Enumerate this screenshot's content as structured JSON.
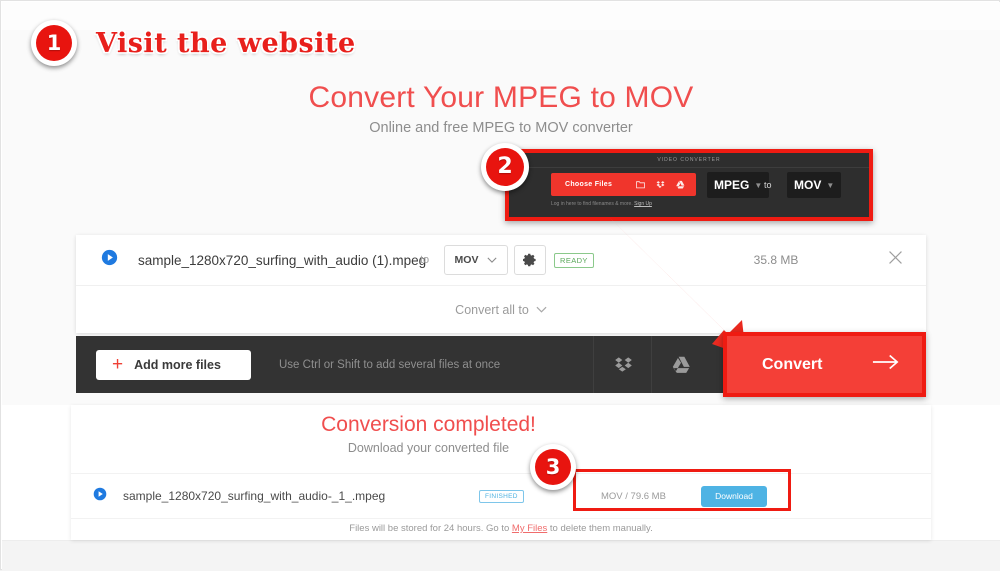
{
  "steps": [
    {
      "number": "1",
      "caption": "Visit the website"
    },
    {
      "number": "2",
      "caption": ""
    },
    {
      "number": "3",
      "caption": ""
    }
  ],
  "hero": {
    "title": "Convert Your MPEG to MOV",
    "subtitle": "Online and free MPEG to MOV converter"
  },
  "widget": {
    "tab_label": "Video Converter",
    "choose_files_label": "Choose Files",
    "icons": [
      "folder-icon",
      "dropbox-icon",
      "google-drive-icon"
    ],
    "format_from": "MPEG",
    "format_to_label": "to",
    "format_to": "MOV",
    "note": "Log in here to find filenames & more.",
    "note_link": "Sign Up"
  },
  "file_panel": {
    "play_icon": "play-circle-icon",
    "filename": "sample_1280x720_surfing_with_audio (1).mpeg",
    "to_label": "to",
    "output_format": "MOV",
    "settings_icon": "gear-icon",
    "status_badge": "READY",
    "filesize": "35.8 MB",
    "remove_icon": "close-icon",
    "convert_all_label": "Convert all to"
  },
  "toolbar": {
    "add_more_label": "Add more files",
    "plus_icon": "plus-icon",
    "hint": "Use Ctrl or Shift to add several files at once",
    "dropbox_icon": "dropbox-icon",
    "drive_icon": "google-drive-icon",
    "convert_label": "Convert",
    "convert_arrow_icon": "arrow-right-icon"
  },
  "completed": {
    "title": "Conversion completed!",
    "subtitle": "Download your converted file",
    "play_icon": "play-circle-icon",
    "filename": "sample_1280x720_surfing_with_audio-_1_.mpeg",
    "status_badge": "FINISHED",
    "output_info": "MOV / 79.6 MB",
    "download_label": "Download",
    "footer_prefix": "Files will be stored for 24 hours. Go to ",
    "footer_link": "My Files",
    "footer_suffix": " to delete them manually."
  },
  "colors": {
    "brand_red": "#f04e4e",
    "highlight_red": "#ef1b12",
    "badge_red": "#e8140f",
    "convert_red": "#f43f37",
    "download_blue": "#4eb3e4",
    "ready_green": "#5aa75a",
    "dark_panel": "#333333"
  }
}
